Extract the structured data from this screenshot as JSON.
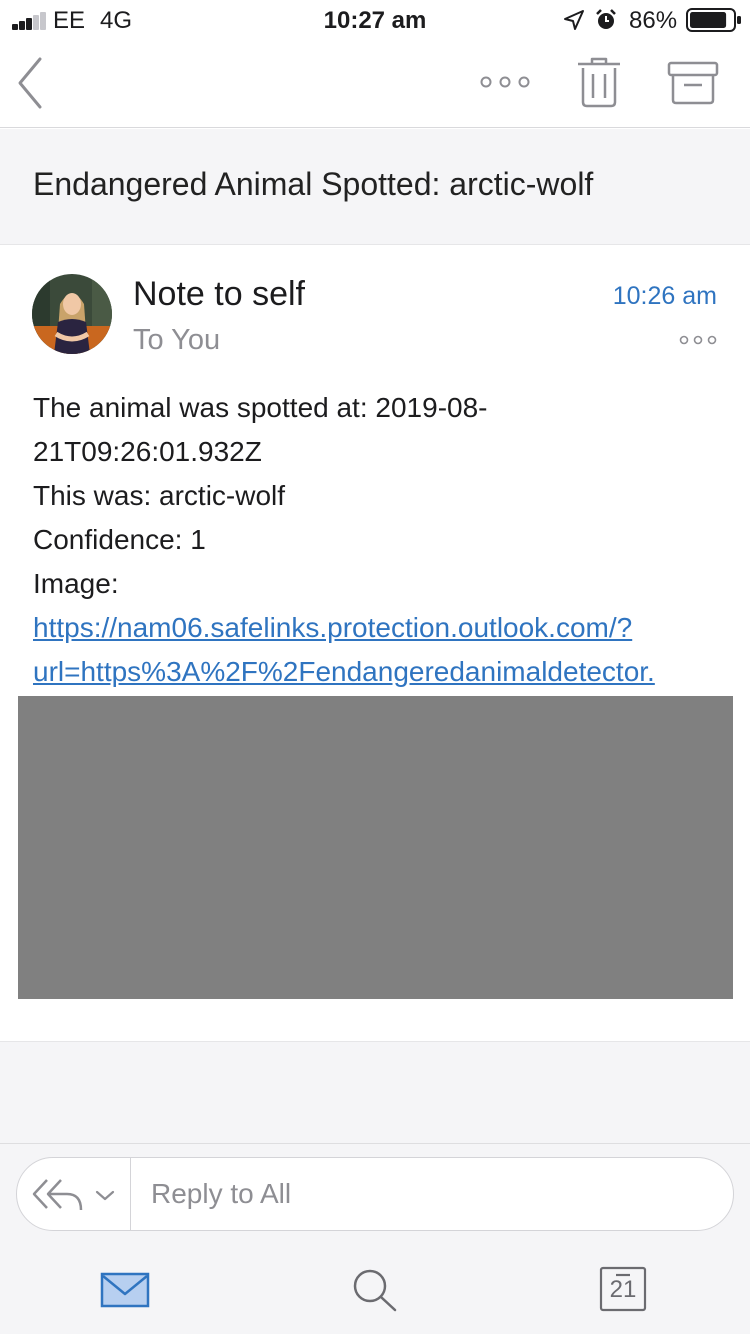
{
  "status_bar": {
    "carrier": "EE",
    "network": "4G",
    "time": "10:27 am",
    "battery_percent": "86%",
    "battery_level": 0.86,
    "signal_bars": 3,
    "signal_total": 5,
    "icons": [
      "signal-icon",
      "location-icon",
      "alarm-icon",
      "battery-icon"
    ]
  },
  "nav_bar": {
    "icons": [
      "back-chevron-icon",
      "more-horizontal-icon",
      "trash-icon",
      "archive-icon"
    ]
  },
  "email": {
    "subject": "Endangered Animal Spotted: arctic-wolf",
    "sender": "Note to self",
    "recipient": "To You",
    "time": "10:26 am",
    "body_lines": [
      "The animal was spotted at: 2019-08-",
      "21T09:26:01.932Z",
      "This was: arctic-wolf",
      "Confidence: 1",
      "Image:"
    ],
    "link_lines": [
      "https://nam06.safelinks.protection.outlook.com/?",
      "url=https%3A%2F%2Fendangeredanimaldetector."
    ]
  },
  "reply": {
    "placeholder": "Reply to All"
  },
  "tab_bar": {
    "calendar_day": "21",
    "icons": [
      "mail-icon",
      "search-icon",
      "calendar-icon"
    ]
  },
  "colors": {
    "accent": "#2f74c0",
    "subject_background": "#f5f5f7",
    "image_placeholder": "#808080"
  }
}
